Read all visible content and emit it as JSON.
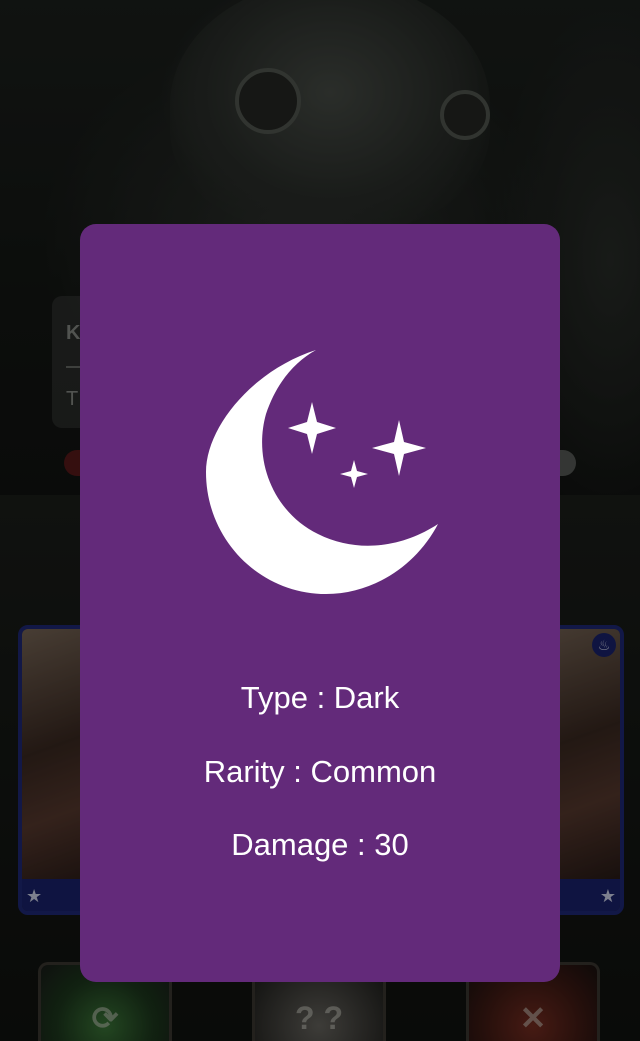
{
  "background": {
    "info_panel": {
      "line1": "K",
      "line2": "T"
    },
    "action_tiles": [
      {
        "name": "refresh",
        "glyph": "⟳"
      },
      {
        "name": "draw",
        "glyph": "? ?"
      },
      {
        "name": "attack",
        "glyph": "✕"
      }
    ],
    "cards": {
      "star_glyph": "★",
      "element_glyph": "♨"
    }
  },
  "modal": {
    "background_color": "#632a7a",
    "icon": "crescent-moon-stars-icon",
    "type_line": "Type : Dark",
    "rarity_line": "Rarity : Common",
    "damage_line": "Damage : 30"
  }
}
